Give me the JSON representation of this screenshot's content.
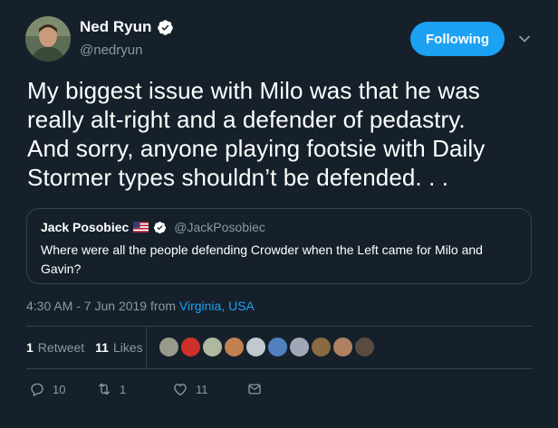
{
  "author": {
    "name": "Ned Ryun",
    "handle": "@nedryun",
    "verified": true
  },
  "follow_button": {
    "label": "Following"
  },
  "tweet": {
    "text_lines": [
      "My biggest issue with Milo was that he was",
      "really alt-right and a defender of pedastry.",
      "And sorry, anyone playing footsie with Daily",
      "Stormer types shouldn’t be defended. . ."
    ]
  },
  "quoted_tweet": {
    "name": "Jack Posobiec",
    "handle": "@JackPosobiec",
    "verified": true,
    "text_lines": [
      "Where were all the people defending Crowder when the Left came for Milo and",
      "Gavin?"
    ]
  },
  "meta": {
    "time": "4:30 AM - 7 Jun 2019 from ",
    "location": "Virginia, USA"
  },
  "stats": {
    "retweets_count": "1",
    "retweets_label": "Retweet",
    "likes_count": "11",
    "likes_label": "Likes"
  },
  "liker_avatar_colors": [
    "#9a9a8a",
    "#d0302a",
    "#b0b8a0",
    "#c08050",
    "#c0c8d0",
    "#5080c0",
    "#a0a8b8",
    "#8a6a40",
    "#b08060",
    "#5a4a40"
  ],
  "actions": {
    "reply_count": "10",
    "retweet_count": "1",
    "like_count": "11"
  },
  "colors": {
    "background": "#15202b",
    "accent": "#1da1f2",
    "secondary_text": "#8899a6",
    "border": "#38444d"
  }
}
